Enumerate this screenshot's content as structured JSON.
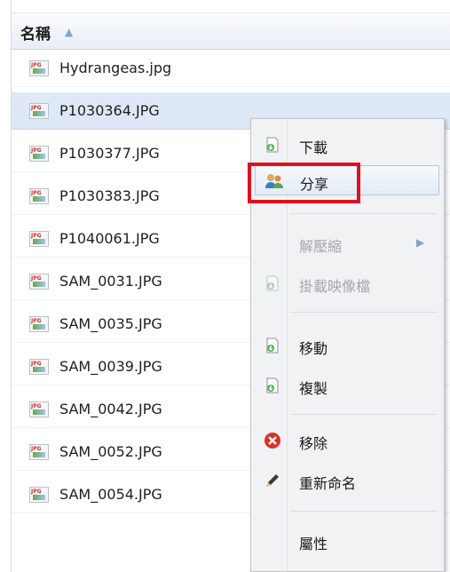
{
  "list": {
    "header_label": "名稱",
    "sort_icon": "▲",
    "rows": [
      {
        "name": "Hydrangeas.jpg",
        "selected": false
      },
      {
        "name": "P1030364.JPG",
        "selected": true
      },
      {
        "name": "P1030377.JPG",
        "selected": false
      },
      {
        "name": "P1030383.JPG",
        "selected": false
      },
      {
        "name": "P1040061.JPG",
        "selected": false
      },
      {
        "name": "SAM_0031.JPG",
        "selected": false
      },
      {
        "name": "SAM_0035.JPG",
        "selected": false
      },
      {
        "name": "SAM_0039.JPG",
        "selected": false
      },
      {
        "name": "SAM_0042.JPG",
        "selected": false
      },
      {
        "name": "SAM_0052.JPG",
        "selected": false
      },
      {
        "name": "SAM_0054.JPG",
        "selected": false
      }
    ]
  },
  "context_menu": {
    "items": [
      {
        "id": "download",
        "label": "下載",
        "icon": "file-download-icon",
        "disabled": false
      },
      {
        "id": "share",
        "label": "分享",
        "icon": "users-share-icon",
        "disabled": false,
        "hover": true
      },
      {
        "id": "extract",
        "label": "解壓縮",
        "icon": "",
        "disabled": true,
        "submenu": true
      },
      {
        "id": "mount-iso",
        "label": "掛載映像檔",
        "icon": "file-download-icon",
        "disabled": true
      },
      {
        "id": "move",
        "label": "移動",
        "icon": "file-download-icon",
        "disabled": false
      },
      {
        "id": "copy",
        "label": "複製",
        "icon": "file-download-icon",
        "disabled": false
      },
      {
        "id": "delete",
        "label": "移除",
        "icon": "red-x-icon",
        "disabled": false
      },
      {
        "id": "rename",
        "label": "重新命名",
        "icon": "pencil-icon",
        "disabled": false
      },
      {
        "id": "properties",
        "label": "屬性",
        "icon": "",
        "disabled": false
      }
    ],
    "submenu_arrow": "▶"
  },
  "colors": {
    "selected_row": "#dfe8f6",
    "highlight_border": "#e01020",
    "disabled_text": "#a4a7ab"
  }
}
